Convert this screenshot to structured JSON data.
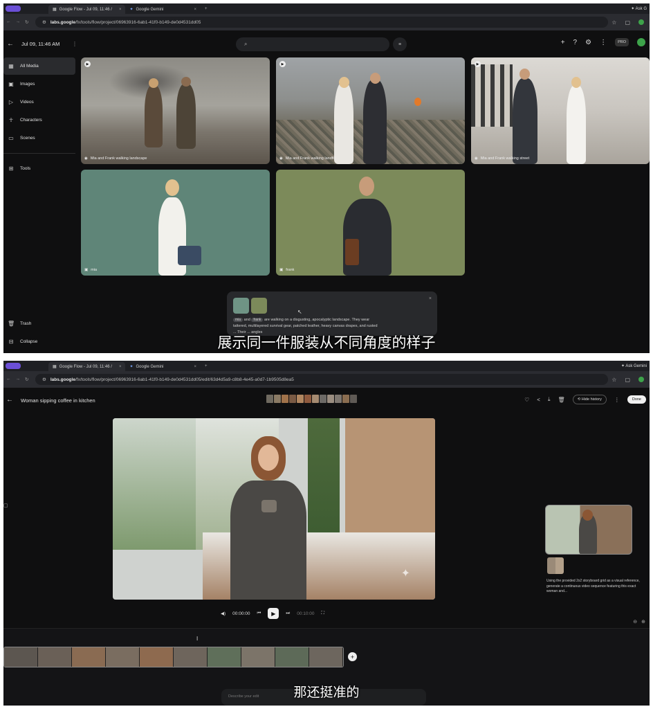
{
  "shot1": {
    "browser": {
      "tabs": [
        {
          "label": "Google Flow - Jul 09, 11:46 /",
          "active": true
        },
        {
          "label": "Google Gemini",
          "active": false
        }
      ],
      "ask_label": "Ask G",
      "url_host": "labs.google",
      "url_path": "/fx/tools/flow/project/06963916-6ab1-41f0-b149-de0d4531dd05"
    },
    "header": {
      "title": "Jul 09, 11:46 AM",
      "pro_badge": "PRO"
    },
    "sidebar": {
      "items": [
        {
          "label": "All Media",
          "icon": "grid-icon",
          "selected": true
        },
        {
          "label": "Images",
          "icon": "image-icon",
          "selected": false
        },
        {
          "label": "Videos",
          "icon": "video-icon",
          "selected": false
        },
        {
          "label": "Characters",
          "icon": "person-icon",
          "selected": false
        },
        {
          "label": "Scenes",
          "icon": "scene-icon",
          "selected": false
        }
      ],
      "tools_label": "Tools",
      "trash_label": "Trash",
      "collapse_label": "Collapse"
    },
    "media": [
      {
        "caption": "Mia and Frank walking landscape"
      },
      {
        "caption": "Mia and Frank walking landfill"
      },
      {
        "caption": "Mia and Frank walking street"
      },
      {
        "caption": "mia"
      },
      {
        "caption": "frank"
      }
    ],
    "prompt": {
      "chip1": "mia",
      "and": "and",
      "chip2": "frank",
      "line1": "are walking on a disgusting, apocalyptic landscape. They wear",
      "line2": "tattered, multilayered survival gear, patched leather, heavy canvas drapes, and rusted",
      "line3": "... Their ... angles"
    },
    "subtitle": "展示同一件服装从不同角度的样子"
  },
  "shot2": {
    "browser": {
      "tabs": [
        {
          "label": "Google Flow - Jul 09, 11:46 /",
          "active": true
        },
        {
          "label": "Google Gemini",
          "active": false
        }
      ],
      "ask_label": "Ask Gemini",
      "url_host": "labs.google",
      "url_path": "/fx/tools/flow/project/06963916-6ab1-41f0-b149-de0d4531dd05/edit/63d4d5a9-c8b8-4e45-a0d7-1b9505d8ea5"
    },
    "header": {
      "title": "Woman sipping coffee in kitchen",
      "hide_history": "Hide history",
      "done": "Done"
    },
    "player": {
      "current_time": "00:00:00",
      "total_time": "00:10:00"
    },
    "side_panel": {
      "text": "Using the provided 2x2 storyboard grid as a visual reference, generate a continuous video sequence featuring this exact woman and..."
    },
    "bottom_input_placeholder": "Describe your edit",
    "subtitle": "那还挺准的"
  }
}
